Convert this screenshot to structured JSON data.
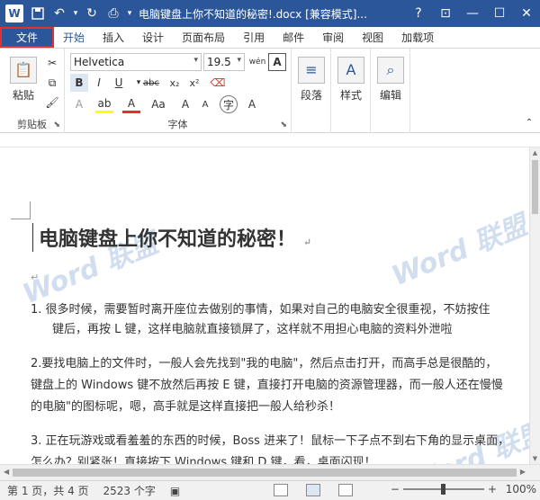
{
  "titlebar": {
    "app_icon": "W",
    "title": "电脑键盘上你不知道的秘密!.docx [兼容模式]...",
    "help": "?",
    "window_controls": {
      "minimize": "—",
      "maximize": "☐",
      "close": "✕"
    }
  },
  "tabs": {
    "file": "文件",
    "items": [
      "开始",
      "插入",
      "设计",
      "页面布局",
      "引用",
      "邮件",
      "审阅",
      "视图",
      "加载项"
    ]
  },
  "ribbon": {
    "clipboard": {
      "paste": "粘贴",
      "label": "剪贴板"
    },
    "font": {
      "family": "Helvetica",
      "size": "19.5",
      "wen": "wén",
      "label": "字体"
    },
    "paragraph": {
      "label": "段落"
    },
    "styles": {
      "label": "样式"
    },
    "editing": {
      "label": "编辑"
    }
  },
  "document": {
    "title": "电脑键盘上你不知道的秘密！",
    "p1_line1": "1.   很多时候，需要暂时离开座位去做别的事情，如果对自己的电脑安全很重视，不妨按住",
    "p1_line2": "键后，再按 L 键，这样电脑就直接锁屏了，这样就不用担心电脑的资料外泄啦",
    "p2_line1": "2.要找电脑上的文件时，一般人会先找到\"我的电脑\"，然后点击打开，而高手总是很酷的，",
    "p2_line2": "键盘上的 Windows 键不放然后再按 E 键，直接打开电脑的资源管理器，而一般人还在慢慢",
    "p2_line3": "的电脑\"的图标呢，嗯，高手就是这样直接把一般人给秒杀！",
    "p3_line1": "3. 正在玩游戏或看羞羞的东西的时候，Boss 进来了！鼠标一下子点不到右下角的显示桌面，",
    "p3_line2": "怎么办？别紧张！直接按下 Windows 键和 D 键，看，桌面闪现！",
    "watermark": "Word 联盟"
  },
  "statusbar": {
    "page": "第 1 页，共 4 页",
    "words": "2523 个字",
    "zoom": "100%",
    "zoom_out": "−",
    "zoom_in": "+"
  }
}
